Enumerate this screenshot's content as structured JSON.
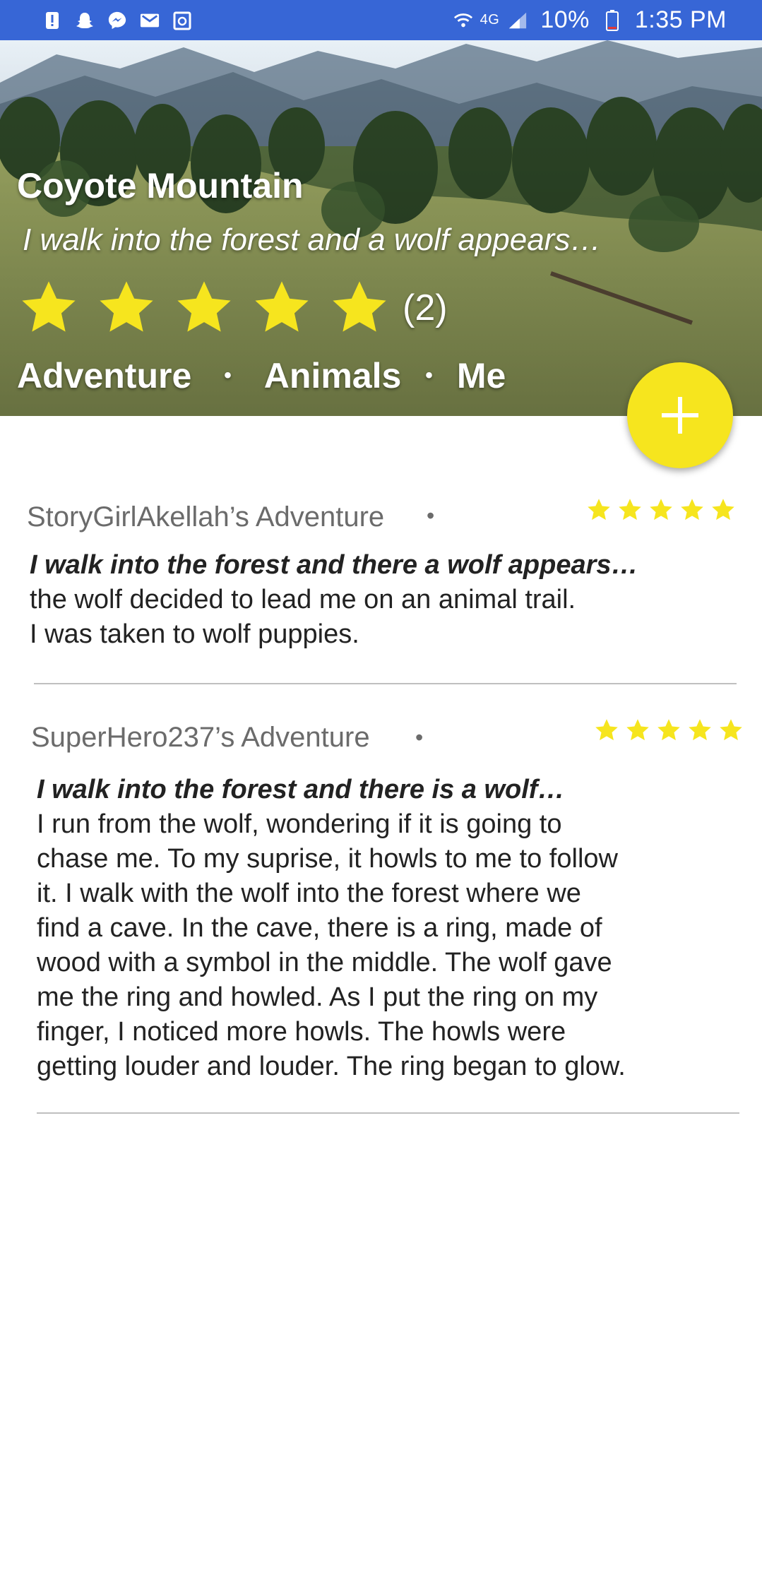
{
  "status_bar": {
    "battery": "10%",
    "time": "1:35 PM",
    "network": "4G",
    "icons_left": [
      "alert-icon",
      "snapchat-icon",
      "messenger-icon",
      "gmail-icon",
      "calendar-icon"
    ],
    "icons_right": [
      "wifi-icon",
      "signal-icon",
      "battery-icon"
    ]
  },
  "hero": {
    "title": "Coyote Mountain",
    "subtitle": "I walk into the forest and a wolf appears…",
    "rating": 5,
    "rating_count": "(2)",
    "tags": [
      "Adventure",
      "Animals",
      "Me"
    ],
    "tag_separator": "•"
  },
  "fab": {
    "icon": "plus-icon"
  },
  "stories": [
    {
      "author": "StoryGirlAkellah’s Adventure",
      "separator": "•",
      "rating": 5,
      "prompt": "I walk into the forest and there a wolf appears…",
      "lines": [
        "the wolf decided to lead me on an animal trail.",
        "I was taken to wolf puppies."
      ]
    },
    {
      "author": "SuperHero237’s Adventure",
      "separator": "•",
      "rating": 5,
      "prompt": "I walk into the forest and there is a wolf…",
      "lines": [
        "I run from the wolf, wondering if it is going to",
        "chase me.  To my suprise, it howls to me to follow",
        "it.  I walk with the wolf into the forest where we",
        "find a cave.  In the cave, there is a ring, made of",
        "wood with a symbol in the middle.  The wolf gave",
        "me the ring and howled.  As I put the ring on my",
        "finger, I noticed more howls.  The howls were",
        "getting louder and louder.  The ring began to glow."
      ]
    }
  ],
  "colors": {
    "status_bar": "#3766d6",
    "star": "#f6e51e",
    "fab": "#f6e51e",
    "author_text": "#6b6b6b",
    "divider": "#bfbfbf"
  }
}
